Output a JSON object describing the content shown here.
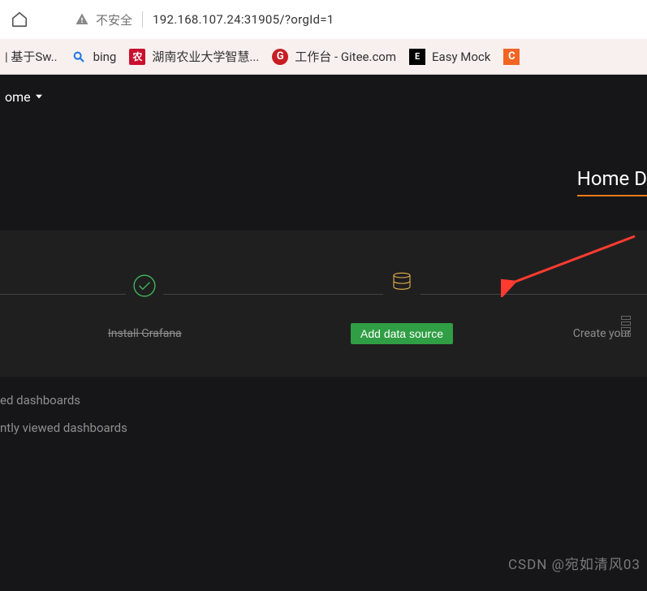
{
  "browser": {
    "security_label": "不安全",
    "url": "192.168.107.24:31905/?orgId=1",
    "bookmarks": [
      {
        "label": "| 基于Sw..",
        "icon": "none"
      },
      {
        "label": "bing",
        "icon": "search"
      },
      {
        "label": "湖南农业大学智慧...",
        "icon": "red-square"
      },
      {
        "label": "工作台 - Gitee.com",
        "icon": "gitee"
      },
      {
        "label": "Easy Mock",
        "icon": "em"
      },
      {
        "label": "",
        "icon": "orange-c"
      }
    ]
  },
  "app": {
    "nav_label": "ome",
    "page_title": "Home D",
    "steps": {
      "install": {
        "label": "Install Grafana"
      },
      "datasource": {
        "button": "Add data source"
      },
      "dashboard": {
        "label": "Create your "
      }
    },
    "sections": {
      "starred": "ed dashboards",
      "recent": "ntly viewed dashboards"
    }
  },
  "watermark": "CSDN @宛如清风03"
}
